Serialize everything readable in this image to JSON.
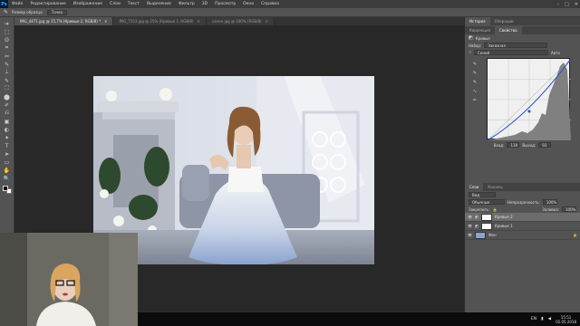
{
  "menubar": {
    "logo": "Ps",
    "items": [
      "Файл",
      "Редактирование",
      "Изображение",
      "Слои",
      "Текст",
      "Выделение",
      "Фильтр",
      "3D",
      "Просмотр",
      "Окно",
      "Справка"
    ],
    "window_controls": [
      "–",
      "□",
      "✕"
    ]
  },
  "options_bar": {
    "tool_hint": "Размер образца:",
    "sample_value": "Точка"
  },
  "doc_tabs": [
    {
      "label": "IMG_4471.jpg @ 15,7% (Кривые 2, RGB/8) *",
      "close": "✕"
    },
    {
      "label": "IMG_7153.jpg @ 25% (Кривые 1, RGB/8)",
      "close": "✕"
    },
    {
      "label": "сапен.jpg @ 100% (RGB/8)",
      "close": "✕"
    }
  ],
  "tools": [
    "➔",
    "⬚",
    "ʘ",
    "⌗",
    "✂",
    "✎",
    "⟘",
    "✎",
    "⛶",
    "⬤",
    "✐",
    "⎌",
    "▣",
    "◐",
    "✦",
    "T",
    "➤",
    "▭",
    "✋",
    "🔍"
  ],
  "panels": {
    "top_tabs": [
      "История",
      "Операции"
    ],
    "props_tabs": [
      "Коррекция",
      "Свойства"
    ],
    "curves_title": "Кривые",
    "preset_label": "Набор:",
    "preset_value": "Заказная",
    "channel_value": "Синий",
    "auto_label": "Авто",
    "input_label": "Вход:",
    "input_value": "128",
    "output_label": "Выход:",
    "output_value": "93",
    "layers_tabs": [
      "Слои",
      "Каналы"
    ],
    "kind_label": "Вид",
    "blend_mode": "Обычные",
    "opacity_label": "Непрозрачность:",
    "opacity_value": "100%",
    "lock_label": "Закрепить:",
    "fill_label": "Заливка:",
    "fill_value": "100%",
    "layers": [
      {
        "name": "Кривые 2",
        "selected": true
      },
      {
        "name": "Кривые 1",
        "selected": false
      },
      {
        "name": "Фон",
        "selected": false
      }
    ]
  },
  "taskbar": {
    "lang": "EN",
    "time": "15:51",
    "date": "02.05.2018"
  },
  "colors": {
    "ps_blue": "#31a8ff",
    "panel_bg": "#535353",
    "canvas_bg": "#282828"
  }
}
